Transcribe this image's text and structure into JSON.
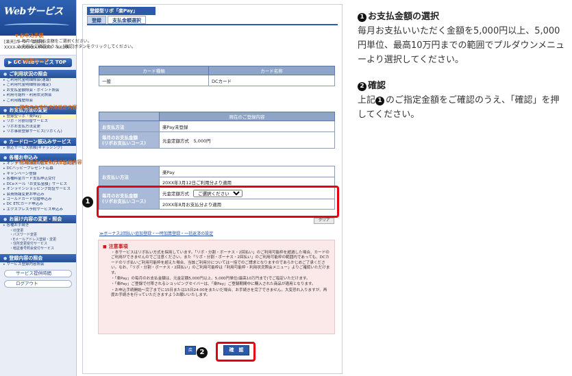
{
  "sidebar": {
    "logo": "Webサービス",
    "user_lines": [
      "[楽天]カード　会員名",
      "XXXX-XXXX-XXXX-XXXX　XX:XX"
    ],
    "top_button": "DC Webサービス TOP",
    "sections": [
      {
        "title": "ご利用状況の照会",
        "items": [
          "ご利用代金明細照会(速報)",
          "ご利用代金明細照会(確定)",
          "お支払金額照会・ポイント照会",
          "利用可能枠・利用状況照会",
          "ご利用履歴照会"
        ]
      },
      {
        "title": "お支払方法の変更",
        "items": [
          "登録型リボ「楽Pay」",
          "リボ・分割切替サービス",
          "リボお支払方法変更",
          "リボ事前登録サービス(リボくん)"
        ]
      },
      {
        "title": "カードローン振込みサービス",
        "items": [
          "振込サービス依頼(キャッシング)"
        ]
      },
      {
        "title": "各種お申込み",
        "items": [
          "オンライン明細書切替サービス／ご利用代金明細書サービス",
          "DCハッピープレゼント応募",
          "キャンペーン登録",
          "各種料金カード支払申込受付",
          "DCeメール「お支払金額」サービス",
          "オンラインショッピング認証サービス",
          "会員情報変更お申込み",
          "ゴールドカード切替申込み",
          "DC ETCカード申込み",
          "エクスプレス予約サービス申込み"
        ]
      },
      {
        "title": "お届け内容の変更・照会",
        "items": [
          "各種お手続き"
        ],
        "subs": [
          "・ID変更",
          "・パスワード変更",
          "・Eメールアドレス登録・変更",
          "・住所変更受付サービス",
          "・暗証番号照会受付サービス"
        ]
      },
      {
        "title": "登録内容の照会",
        "items": [
          "サービス登録内容照会"
        ]
      }
    ],
    "bottom_buttons": [
      "サービス提供時間",
      "ログアウト"
    ]
  },
  "main": {
    "title": "登録型リボ「楽Pay」",
    "tabs": [
      "登録",
      "支払金額選択"
    ],
    "apply": {
      "heading": "お申込手続",
      "lines": [
        "1 毎月のお支払金額をご選択ください。",
        "2 内容をご確認のうえ、[確認]ボタンをクリックしてください。"
      ]
    },
    "card": {
      "heading": "ご選択カード",
      "headers": [
        "カード種類",
        "カード名称"
      ],
      "row": [
        "一般",
        "DCカード"
      ]
    },
    "current": {
      "heading": "現在のお支払方法設定内容",
      "col_header": "現在のご登録内容",
      "method_label": "お支払方法",
      "method_value": "楽Pay未登録",
      "amount_label": "毎月のお支払金額",
      "amount_label_sub": "(リボお支払いコース)",
      "amount_value": "元金定額方式　5,000円"
    },
    "after": {
      "heading": "登録後のお支払方法設定内容",
      "method_label": "お支払い方法",
      "method_value": "楽Pay",
      "method_note": "20XX年3月12日ご利用分より適用",
      "amount_label": "毎月のお支払金額",
      "amount_label_sub": "(リボお支払いコース)",
      "amount_prefix": "元金定額方式",
      "select_value": "ご選択ください",
      "amount_note": "20XX年8月お支払分より適用",
      "clear_label": "クリア"
    },
    "bonus_link": "≫ボーナス2回払い追加登録・一時加算登録・一括返済の設定",
    "notes": {
      "title": "注意事項",
      "paras": [
        "・本サービスはリボ払い方式を採用しています。「リボ・分割・ボーナス・2回払い」のご利用可能枠を超過した場合、カードのご利用ができませんのでご注意ください。また「リボ・分割・ボーナス・2回払い」のご利用可能枠の範囲内であっても、DCカードのリボ払いご利用可能枠を超えた場合、当該ご利用分については一括でのご請求となりますのであらかじめご了承ください。なお、「リボ・分割・ボーナス・2回払い」のご利用可能枠は「利用可能枠・利用状況照会メニュー」よりご確認いただけます。",
        "・「楽Pay」の毎月のお支払金額は、元金定額5,000円以上、5,000円単位(最高10万円まで)でご指定いただけます。",
        "・「楽Pay」ご登録で付帯されるショッピングセイバーは、「楽Pay」ご登録期間中に購入された商品が適用となります。",
        "・お申込手続開始〜完了までに15日または15日24:00をまたいだ場合、お手続きを完了できません。大変恐れ入りますが、再度お手続きを行っていただきますようお願いいたします。"
      ]
    },
    "back_label": "戻",
    "confirm_label": "確　認"
  },
  "markers": [
    "1",
    "2"
  ],
  "instructions": [
    {
      "num": "1",
      "title": "お支払金額の選択",
      "body": "毎月お支払いいただく金額を5,000円以上、5,000円単位、最高10万円までの範囲でプルダウンメニューより選択してください。"
    },
    {
      "num": "2",
      "title": "確認",
      "body_prefix": "上記",
      "body_num": "1",
      "body": "のご指定金額をご確認のうえ、「確認」を押してください。"
    }
  ],
  "colors": {
    "accent": "#2a5aa8",
    "section": "#d2691e",
    "highlight": "#e60012",
    "notice_bg": "#fbe9e9"
  }
}
